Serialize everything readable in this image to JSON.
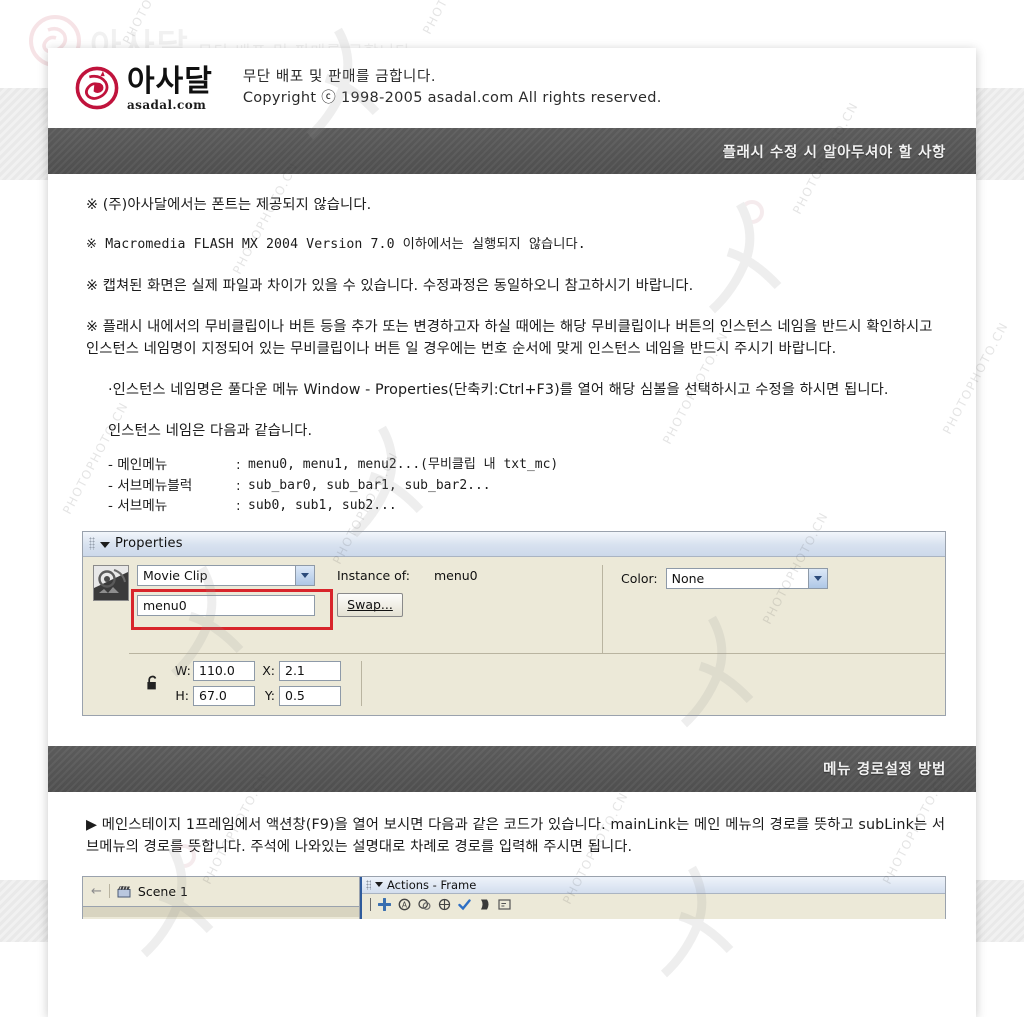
{
  "header": {
    "logo_hangul": "아사달",
    "logo_latin": "asadal.com",
    "line1": "무단 배포 및 판매를 금합니다.",
    "line2": "Copyright ⓒ 1998-2005 asadal.com All rights reserved."
  },
  "sections": [
    {
      "title": "플래시 수정 시 알아두셔야 할 사항"
    },
    {
      "title": "메뉴 경로설정 방법"
    }
  ],
  "notices": [
    "※ (주)아사달에서는 폰트는 제공되지 않습니다.",
    "※ Macromedia FLASH MX 2004 Version 7.0 이하에서는 실행되지 않습니다.",
    "※ 캡쳐된 화면은 실제 파일과 차이가 있을 수 있습니다. 수정과정은 동일하오니 참고하시기 바랍니다."
  ],
  "notice4": "※ 플래시 내에서의 무비클립이나 버튼 등을 추가 또는 변경하고자 하실 때에는 해당 무비클립이나 버튼의 인스턴스 네임을 반드시 확인하시고 인스턴스 네임명이 지정되어 있는 무비클립이나 버튼 일 경우에는 번호 순서에 맞게 인스턴스 네임을 반드시 주시기 바랍니다.",
  "bullet1": "·인스턴스 네임명은 풀다운 메뉴 Window - Properties(단축키:Ctrl+F3)를 열어 해당 심볼을 선택하시고 수정을 하시면 됩니다.",
  "bullet2": "인스턴스 네임은 다음과 같습니다.",
  "instance_list": [
    {
      "label": "- 메인메뉴",
      "colon": ":",
      "value": "menu0, menu1, menu2...(무비클립 내 txt_mc)"
    },
    {
      "label": "- 서브메뉴블럭",
      "colon": ":",
      "value": "sub_bar0, sub_bar1, sub_bar2..."
    },
    {
      "label": "- 서브메뉴",
      "colon": ":",
      "value": "sub0, sub1, sub2..."
    }
  ],
  "properties_panel": {
    "title": "Properties",
    "symbol_type": "Movie Clip",
    "instance_name": "menu0",
    "instance_of_label": "Instance of:",
    "instance_of_value": "menu0",
    "swap_label": "Swap...",
    "color_label": "Color:",
    "color_value": "None",
    "w_label": "W:",
    "w_value": "110.0",
    "h_label": "H:",
    "h_value": "67.0",
    "x_label": "X:",
    "x_value": "2.1",
    "y_label": "Y:",
    "y_value": "0.5",
    "highlight_color": "#d8252b"
  },
  "section2_para": "▶ 메인스테이지 1프레임에서 액션창(F9)을 열어 보시면 다음과 같은 코드가 있습니다. mainLink는 메인 메뉴의 경로를 뜻하고 subLink는 서브메뉴의 경로를 뜻합니다. 주석에 나와있는 설명대로 차례로 경로를 입력해 주시면 됩니다.",
  "ide_strip": {
    "scene_label": "Scene 1",
    "actions_title": "Actions - Frame"
  },
  "watermark": {
    "text": "PHOTOPHOTO.CN"
  }
}
